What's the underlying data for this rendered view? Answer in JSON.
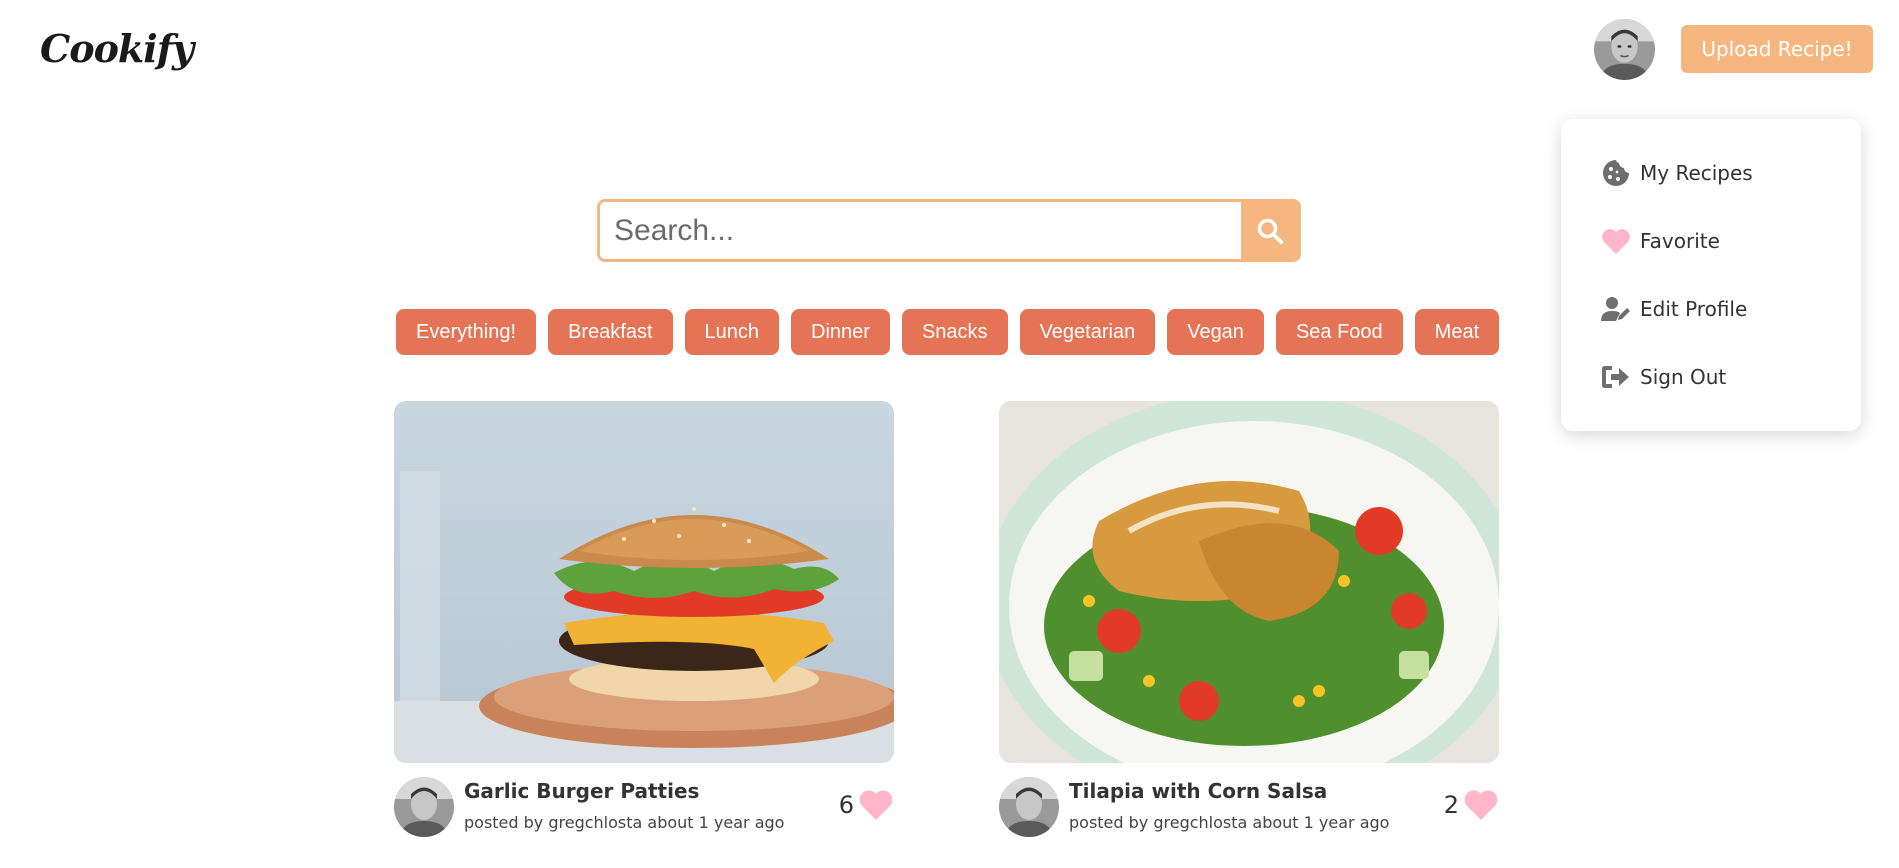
{
  "header": {
    "logo": "Cookify",
    "upload_label": "Upload Recipe!"
  },
  "user_menu": {
    "items": [
      {
        "label": "My Recipes",
        "icon": "cookie-icon"
      },
      {
        "label": "Favorite",
        "icon": "heart-icon"
      },
      {
        "label": "Edit Profile",
        "icon": "user-edit-icon"
      },
      {
        "label": "Sign Out",
        "icon": "sign-out-icon"
      }
    ]
  },
  "search": {
    "placeholder": "Search...",
    "icon": "search-icon"
  },
  "categories": [
    "Everything!",
    "Breakfast",
    "Lunch",
    "Dinner",
    "Snacks",
    "Vegetarian",
    "Vegan",
    "Sea Food",
    "Meat"
  ],
  "recipes": [
    {
      "title": "Garlic Burger Patties",
      "posted_by": "posted by gregchlosta about 1 year ago",
      "likes": "6"
    },
    {
      "title": "Tilapia with Corn Salsa",
      "posted_by": "posted by gregchlosta about 1 year ago",
      "likes": "2"
    }
  ],
  "colors": {
    "accent": "#f5b67f",
    "category": "#e57355",
    "heart": "#ffb6c8"
  }
}
